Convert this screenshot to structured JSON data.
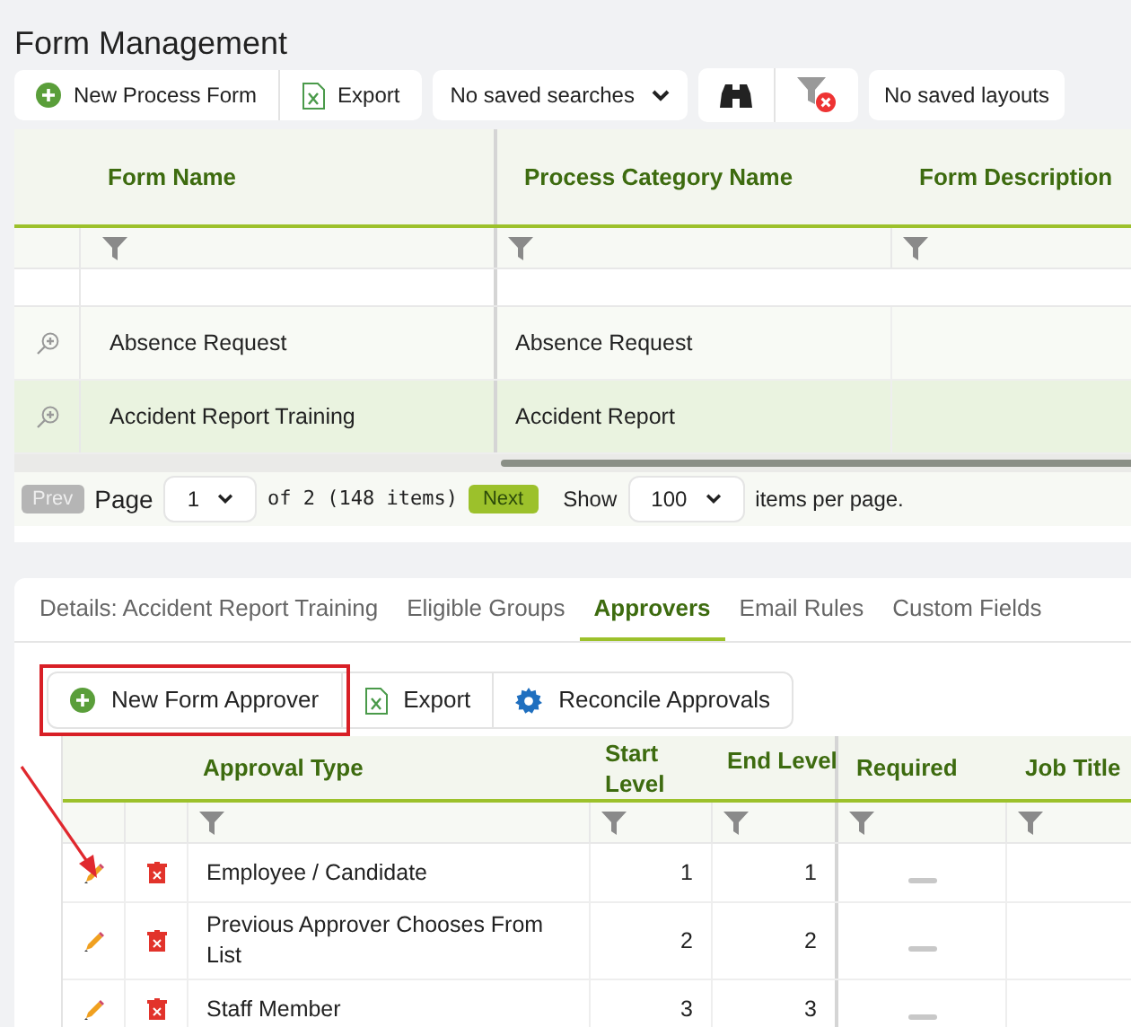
{
  "page_title": "Form Management",
  "toolbar": {
    "buttons": [
      {
        "label": "New Process Form",
        "kind": "add"
      },
      {
        "label": "Export",
        "kind": "excel"
      }
    ],
    "saved_searches": "No saved searches",
    "saved_layouts": "No saved layouts"
  },
  "forms_grid": {
    "columns": [
      "Form Name",
      "Process Category Name",
      "Form Description"
    ],
    "rows": [
      {
        "form_name": "Absence Request",
        "category": "Absence Request",
        "selected": false
      },
      {
        "form_name": "Accident Report Training",
        "category": "Accident Report",
        "selected": true
      }
    ]
  },
  "pager": {
    "prev": "Prev",
    "page_label": "Page",
    "page": "1",
    "of_text": "of 2 (148 items)",
    "next": "Next",
    "show": "Show",
    "page_size": "100",
    "per_page": "items per page."
  },
  "detail_tabs": [
    {
      "label": "Details: Accident Report Training",
      "selected": false
    },
    {
      "label": "Eligible Groups",
      "selected": false
    },
    {
      "label": "Approvers",
      "selected": true
    },
    {
      "label": "Email Rules",
      "selected": false
    },
    {
      "label": "Custom Fields",
      "selected": false
    }
  ],
  "approver_toolbar": {
    "buttons": [
      {
        "label": "New Form Approver",
        "kind": "add",
        "highlighted": true
      },
      {
        "label": "Export",
        "kind": "excel",
        "highlighted": false
      },
      {
        "label": "Reconcile Approvals",
        "kind": "gear",
        "highlighted": false
      }
    ]
  },
  "approvers_grid": {
    "columns": [
      "Approval Type",
      "Start Level",
      "End Level",
      "Required",
      "Job Title"
    ],
    "rows": [
      {
        "approval_type": "Employee / Candidate",
        "start_level": "1",
        "end_level": "1",
        "required": false
      },
      {
        "approval_type": "Previous Approver Chooses From List",
        "start_level": "2",
        "end_level": "2",
        "required": false
      },
      {
        "approval_type": "Staff Member",
        "start_level": "3",
        "end_level": "3",
        "required": false
      }
    ]
  }
}
